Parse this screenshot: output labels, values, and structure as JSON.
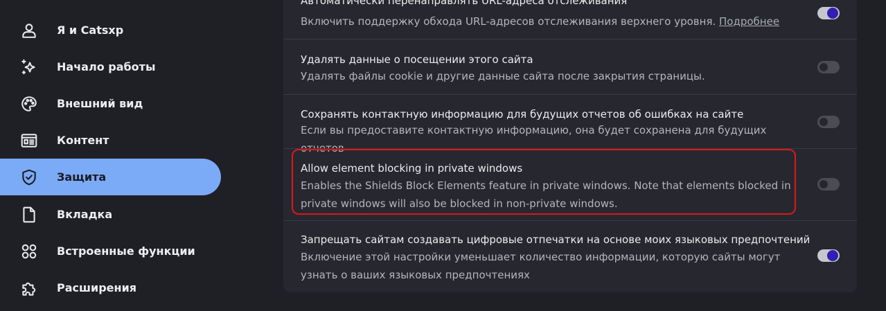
{
  "sidebar": {
    "items": [
      {
        "label": "Я и Catsxp",
        "icon": "person-icon"
      },
      {
        "label": "Начало работы",
        "icon": "sparkle-star-icon"
      },
      {
        "label": "Внешний вид",
        "icon": "palette-icon"
      },
      {
        "label": "Контент",
        "icon": "article-icon"
      },
      {
        "label": "Защита",
        "icon": "shield-check-icon",
        "active": true
      },
      {
        "label": "Вкладка",
        "icon": "page-icon"
      },
      {
        "label": "Встроенные функции",
        "icon": "apps-grid-icon"
      },
      {
        "label": "Расширения",
        "icon": "puzzle-icon"
      }
    ]
  },
  "settings": [
    {
      "title": "Автоматически перенаправлять URL-адреса отслеживания",
      "description": "Включить поддержку обхода URL-адресов отслеживания верхнего уровня.",
      "link": "Подробнее",
      "enabled": true
    },
    {
      "title": "Удалять данные о посещении этого сайта",
      "description": "Удалять файлы cookie и другие данные сайта после закрытия страницы.",
      "enabled": false
    },
    {
      "title": "Сохранять контактную информацию для будущих отчетов об ошибках на сайте",
      "description": "Если вы предоставите контактную информацию, она будет сохранена для будущих отчетов",
      "enabled": false
    },
    {
      "title": "Allow element blocking in private windows",
      "description": "Enables the Shields Block Elements feature in private windows. Note that elements blocked in private windows will also be blocked in non-private windows.",
      "enabled": false,
      "highlighted": true
    },
    {
      "title": "Запрещать сайтам создавать цифровые отпечатки на основе моих языковых предпочтений",
      "description": "Включение этой настройки уменьшает количество информации, которую сайты могут узнать о ваших языковых предпочтениях",
      "enabled": true
    }
  ],
  "colors": {
    "background": "#1f2026",
    "card": "#27282f",
    "active_nav": "#7baaf7",
    "toggle_on_knob": "#2f1fb5",
    "highlight_border": "#e0161c"
  }
}
